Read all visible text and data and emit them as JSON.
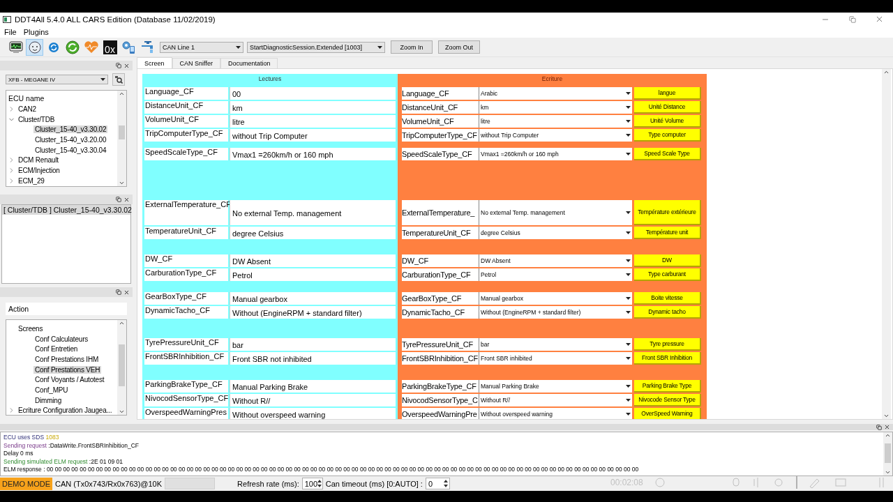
{
  "window": {
    "title": "DDT4All 5.4.0 ALL CARS Edition (Database 11/02/2019)"
  },
  "menu": [
    "File",
    "Plugins"
  ],
  "toolbar": {
    "tools": [
      {
        "kind": "monitor",
        "selected": false
      },
      {
        "kind": "face",
        "selected": true
      },
      {
        "kind": "refresh",
        "selected": false
      },
      {
        "kind": "cycle",
        "selected": false
      },
      {
        "kind": "heart",
        "selected": false
      },
      {
        "kind": "hex",
        "label": "0x",
        "selected": false
      },
      {
        "kind": "gears",
        "selected": false
      },
      {
        "kind": "faucet",
        "selected": false
      }
    ],
    "can_line": "CAN Line 1",
    "session": "StartDiagnosticSession.Extended [1003]",
    "buttons": [
      "Zoom In",
      "Zoom Out"
    ]
  },
  "vehicle": "XFB - MEGANE IV",
  "ecu_tree": {
    "header": "ECU name",
    "items": [
      {
        "label": "CAN2",
        "expanded": false,
        "selected": false
      },
      {
        "label": "Cluster/TDB",
        "expanded": true,
        "selected": false,
        "children": [
          {
            "label": "Cluster_15-40_v3.30.02",
            "selected": true
          },
          {
            "label": "Cluster_15-40_v3.20.00",
            "selected": false
          },
          {
            "label": "Cluster_15-40_v3.30.04",
            "selected": false
          }
        ]
      },
      {
        "label": "DCM Renault",
        "expanded": false,
        "selected": false
      },
      {
        "label": "ECM/Injection",
        "expanded": false,
        "selected": false
      },
      {
        "label": "ECM_29",
        "expanded": false,
        "selected": false
      }
    ]
  },
  "loaded_ecus": [
    {
      "label": "[ Cluster/TDB ] Cluster_15-40_v3.30.02",
      "selected": true
    }
  ],
  "action_field": {
    "placeholder": "Action"
  },
  "screens_tree": {
    "items": [
      {
        "label": "Screens",
        "selected": false,
        "children": [
          {
            "label": "Conf Calculateurs",
            "selected": false
          },
          {
            "label": "Conf Entretien",
            "selected": false
          },
          {
            "label": "Conf Prestations IHM",
            "selected": false
          },
          {
            "label": "Conf Prestations VEH",
            "selected": true
          },
          {
            "label": "Conf Voyants / Autotest",
            "selected": false
          },
          {
            "label": "Conf_MPU",
            "selected": false
          },
          {
            "label": "Dimming",
            "selected": false
          }
        ]
      },
      {
        "label": "Ecriture Configuration Jaugea...",
        "expanded": false,
        "selected": false
      }
    ]
  },
  "tabs": [
    {
      "label": "Screen",
      "selected": true
    },
    {
      "label": "CAN Sniffer",
      "selected": false
    },
    {
      "label": "Documentation",
      "selected": false
    }
  ],
  "lectures": {
    "title": "Lectures",
    "groups": [
      [
        {
          "label": "Language_CF",
          "value": "00"
        },
        {
          "label": "DistanceUnit_CF",
          "value": "km"
        },
        {
          "label": "VolumeUnit_CF",
          "value": "litre"
        },
        {
          "label": "TripComputerType_CF",
          "value": "without Trip Computer"
        }
      ],
      [
        {
          "label": "SpeedScaleType_CF",
          "value": "Vmax1 =260km/h or 160 mph"
        }
      ],
      [
        {
          "label": "ExternalTemperature_CF",
          "value": "No external Temp. management"
        },
        {
          "label": "TemperatureUnit_CF",
          "value": "degree Celsius"
        }
      ],
      [
        {
          "label": "DW_CF",
          "value": "DW Absent"
        },
        {
          "label": "CarburationType_CF",
          "value": "Petrol"
        }
      ],
      [
        {
          "label": "GearBoxType_CF",
          "value": "Manual gearbox"
        },
        {
          "label": "DynamicTacho_CF",
          "value": "Without (EngineRPM + standard filter)"
        }
      ],
      [
        {
          "label": "TyrePressureUnit_CF",
          "value": "bar"
        },
        {
          "label": "FrontSBRInhibition_CF",
          "value": "Front SBR not inhibited"
        }
      ],
      [
        {
          "label": "ParkingBrakeType_CF",
          "value": "Manual Parking Brake"
        },
        {
          "label": "NivocodSensorType_CF",
          "value": "Without R//"
        },
        {
          "label": "OverspeedWarningPres",
          "value": "Without overspeed warning"
        }
      ]
    ]
  },
  "ecriture": {
    "title": "Ecriture",
    "groups": [
      [
        {
          "label": "Language_CF",
          "value": "Arabic",
          "button": "langue"
        },
        {
          "label": "DistanceUnit_CF",
          "value": "km",
          "button": "Unité Distance"
        },
        {
          "label": "VolumeUnit_CF",
          "value": "litre",
          "button": "Unité Volume"
        },
        {
          "label": "TripComputerType_CF",
          "value": "without Trip Computer",
          "button": "Type computer"
        }
      ],
      [
        {
          "label": "SpeedScaleType_CF",
          "value": "Vmax1 =260km/h or 160 mph",
          "button": "Speed Scale Type"
        }
      ],
      [
        {
          "label": "ExternalTemperature_",
          "value": "No external Temp. management",
          "button": "Température extérieure"
        },
        {
          "label": "TemperatureUnit_CF",
          "value": "degree Celsius",
          "button": "Température unit"
        }
      ],
      [
        {
          "label": "DW_CF",
          "value": "DW Absent",
          "button": "DW"
        },
        {
          "label": "CarburationType_CF",
          "value": "Petrol",
          "button": "Type carburant"
        }
      ],
      [
        {
          "label": "GearBoxType_CF",
          "value": "Manual gearbox",
          "button": "Boite vitesse"
        },
        {
          "label": "DynamicTacho_CF",
          "value": "Without (EngineRPM + standard filter)",
          "button": "Dynamic tacho"
        }
      ],
      [
        {
          "label": "TyrePressureUnit_CF",
          "value": "bar",
          "button": "Tyre pressure"
        },
        {
          "label": "FrontSBRInhibition_CF",
          "value": "Front SBR inhibited",
          "button": "Front SBR Inhibition"
        }
      ],
      [
        {
          "label": "ParkingBrakeType_CF",
          "value": "Manual Parking Brake",
          "button": "Parking Brake Type"
        },
        {
          "label": "NivocodSensorType_C",
          "value": "Without R//",
          "button": "Nivocode Sensor Type"
        },
        {
          "label": "OverspeedWarningPre",
          "value": "Without overspeed warning",
          "button": "OverSpeed Warning"
        }
      ]
    ]
  },
  "log": [
    [
      {
        "text": "ECU uses SDS ",
        "kind": "info"
      },
      {
        "text": "1083",
        "kind": "number"
      }
    ],
    [
      {
        "text": "Sending request ",
        "kind": "request"
      },
      {
        "text": ":DataWrite.FrontSBRInhibition_CF",
        "kind": "plain"
      }
    ],
    [
      {
        "text": "Delay 0 ms",
        "kind": "plain"
      }
    ],
    [
      {
        "text": "Sending simulated ELM request ",
        "kind": "elm"
      },
      {
        "text": ":2E 01 09 01",
        "kind": "plain"
      }
    ],
    [
      {
        "text": "ELM response : 00 00 00 00 00 00 00 00 00 00 00 00 00 00 00 00 00 00 00 00 00 00 00 00 00 00 00 00 00 00 00 00 00 00 00 00 00 00 00 00 00 00 00 00 00 00 00 00 00 00 00 00 00 00 00 00 00 00 00 00 00 00 00 00 00 00 00 00 00 00 00 00",
        "kind": "plain"
      }
    ]
  ],
  "status_bar": {
    "mode": "DEMO MODE",
    "connection": "CAN (Tx0x743/Rx0x763)@10K",
    "refresh_label": "Refresh rate (ms):",
    "refresh_value": "100",
    "timeout_label": "Can timeout (ms) [0:AUTO] :",
    "timeout_value": "0"
  },
  "recorder": {
    "time": "00:02:08"
  }
}
